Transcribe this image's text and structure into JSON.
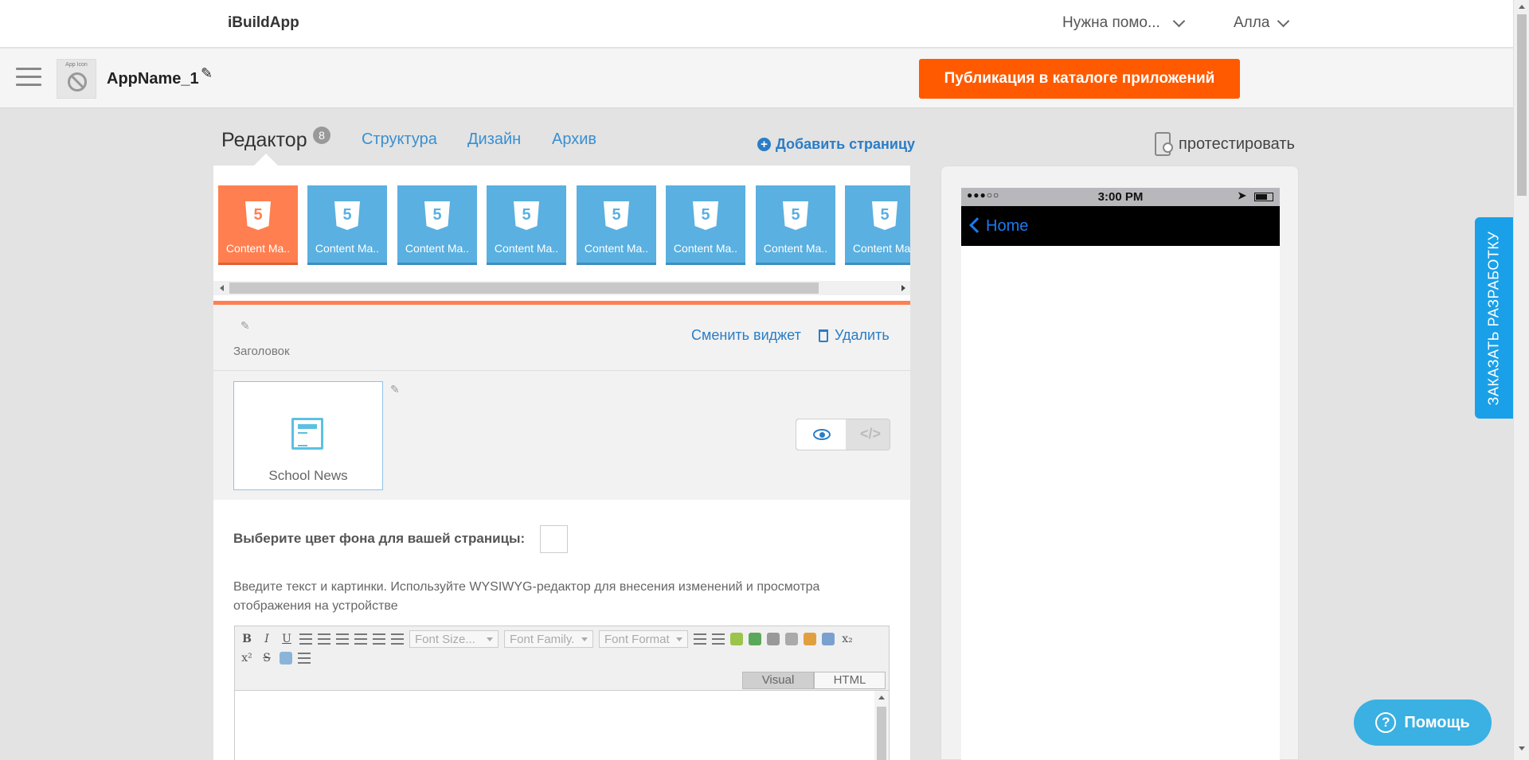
{
  "topbar": {
    "brand": "iBuildApp",
    "help_menu": "Нужна помо...",
    "user_menu": "Алла"
  },
  "appbar": {
    "app_icon_label": "App Icon",
    "app_name": "AppName_1",
    "publish_button": "Публикация в каталоге приложений"
  },
  "tabs": {
    "editor": "Редактор",
    "editor_badge": "8",
    "structure": "Структура",
    "design": "Дизайн",
    "archive": "Архив",
    "add_page": "Добавить страницу",
    "test": "протестировать"
  },
  "pages": [
    {
      "label": "Content Ma..",
      "icon": "html5-icon",
      "active": true
    },
    {
      "label": "Content Ma..",
      "icon": "html5-icon",
      "active": false
    },
    {
      "label": "Content Ma..",
      "icon": "html5-icon",
      "active": false
    },
    {
      "label": "Content Ma..",
      "icon": "html5-icon",
      "active": false
    },
    {
      "label": "Content Ma..",
      "icon": "html5-icon",
      "active": false
    },
    {
      "label": "Content Ma..",
      "icon": "html5-icon",
      "active": false
    },
    {
      "label": "Content Ma..",
      "icon": "html5-icon",
      "active": false
    },
    {
      "label": "Content Ma..",
      "icon": "html5-icon",
      "active": false
    }
  ],
  "widget": {
    "title_label": "Заголовок",
    "change_widget": "Сменить виджет",
    "delete": "Удалить",
    "news_card_label": "School News"
  },
  "content": {
    "bg_color_label": "Выберите цвет фона для вашей страницы:",
    "help_text": "Введите текст и картинки. Используйте WYSIWYG-редактор для внесения изменений и просмотра отображения на устройстве"
  },
  "wysiwyg": {
    "bold": "B",
    "italic": "I",
    "underline": "U",
    "font_size": "Font Size...",
    "font_family": "Font Family.",
    "font_format": "Font Format",
    "subscript": "x₂",
    "superscript": "x²",
    "strike": "S",
    "tab_visual": "Visual",
    "tab_html": "HTML"
  },
  "phone": {
    "time": "3:00 PM",
    "signal": "●●●○○",
    "nav_back": "Home"
  },
  "floating": {
    "order_dev": "ЗАКАЗАТЬ РАЗРАБОТКУ",
    "help_button": "Помощь",
    "help_icon": "?"
  },
  "colors": {
    "accent_orange": "#ff5a00",
    "active_page": "#ff7f50",
    "page_tile": "#5ab0e0",
    "link_blue": "#2a7dc6",
    "help_blue": "#3ab0e3"
  }
}
